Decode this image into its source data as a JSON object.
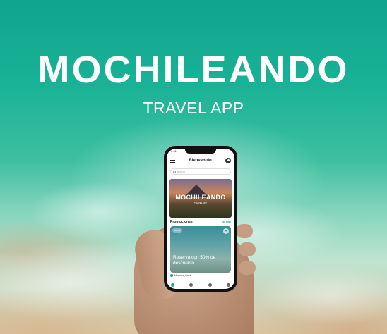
{
  "hero": {
    "title": "MOCHILEANDO",
    "subtitle": "TRAVEL APP"
  },
  "phone": {
    "status_time": "9:41",
    "header_title": "Bienvenido",
    "search_placeholder": "Buscar",
    "banner_title": "MOCHILEANDO",
    "banner_subtitle": "TRAVEL APP",
    "promotions_title": "Promociones",
    "promotions_link": "Ver más",
    "promo_chip": "Oferta",
    "promo_text": "Reserva con 50% de descuento",
    "promo_location": "Mancora, Lima",
    "icons": [
      "menu-icon",
      "user-icon",
      "search-icon",
      "heart-icon",
      "location-icon",
      "home-icon",
      "compass-icon",
      "bag-icon",
      "settings-icon"
    ]
  },
  "colors": {
    "accent": "#17a68e",
    "sea": "#19b296",
    "sand": "#d9c6a4"
  }
}
